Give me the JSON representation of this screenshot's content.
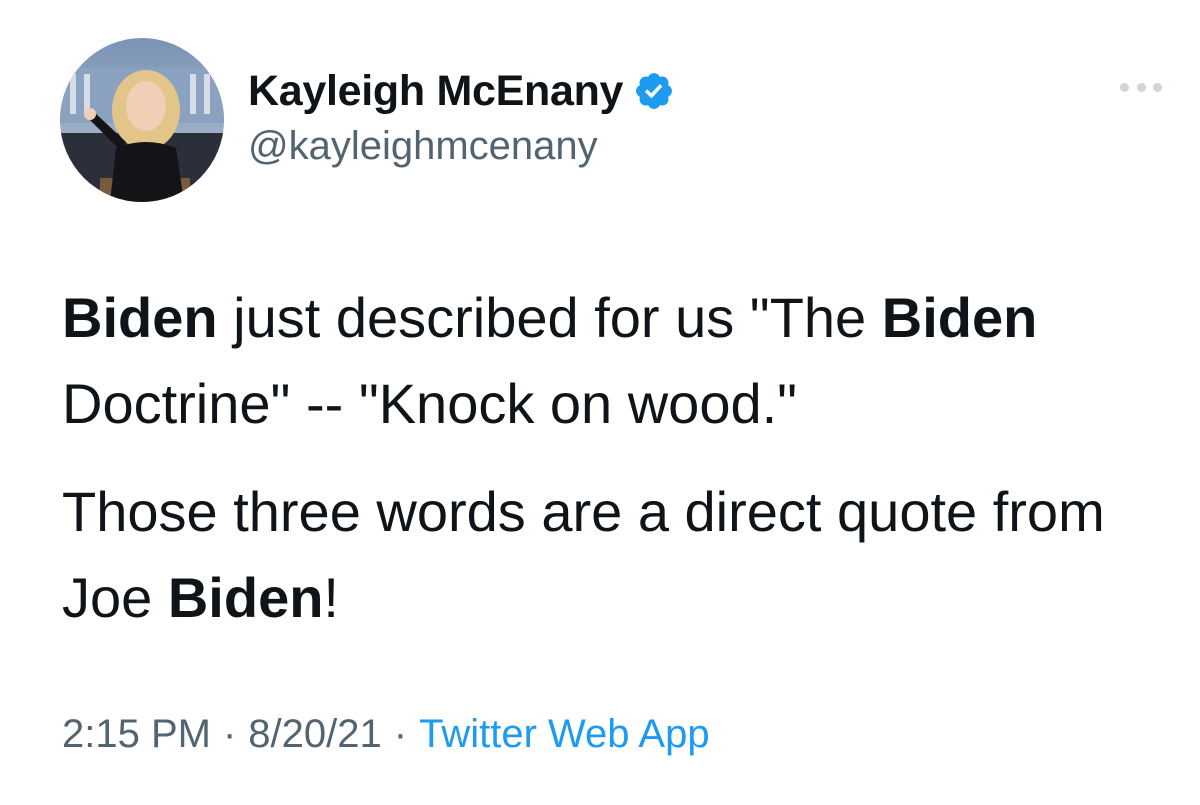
{
  "tweet": {
    "author": {
      "display_name": "Kayleigh McEnany",
      "handle": "@kayleighmcenany",
      "verified_icon": "verified-badge-icon",
      "avatar": "profile-photo"
    },
    "body": {
      "p1_s1": "Biden",
      "p1_s2": " just described for us \"The ",
      "p1_s3": "Biden",
      "p1_s4": " Doctrine\" -- \"Knock on wood.\"",
      "p2_s1": "Those three words are a direct quote from Joe ",
      "p2_s2": "Biden",
      "p2_s3": "!"
    },
    "meta": {
      "time": "2:15 PM",
      "separator": "·",
      "date": "8/20/21",
      "source": "Twitter Web App"
    },
    "more_icon": "more-options-icon"
  },
  "colors": {
    "text": "#0f1419",
    "secondary": "#536471",
    "accent": "#1d9bf0"
  }
}
